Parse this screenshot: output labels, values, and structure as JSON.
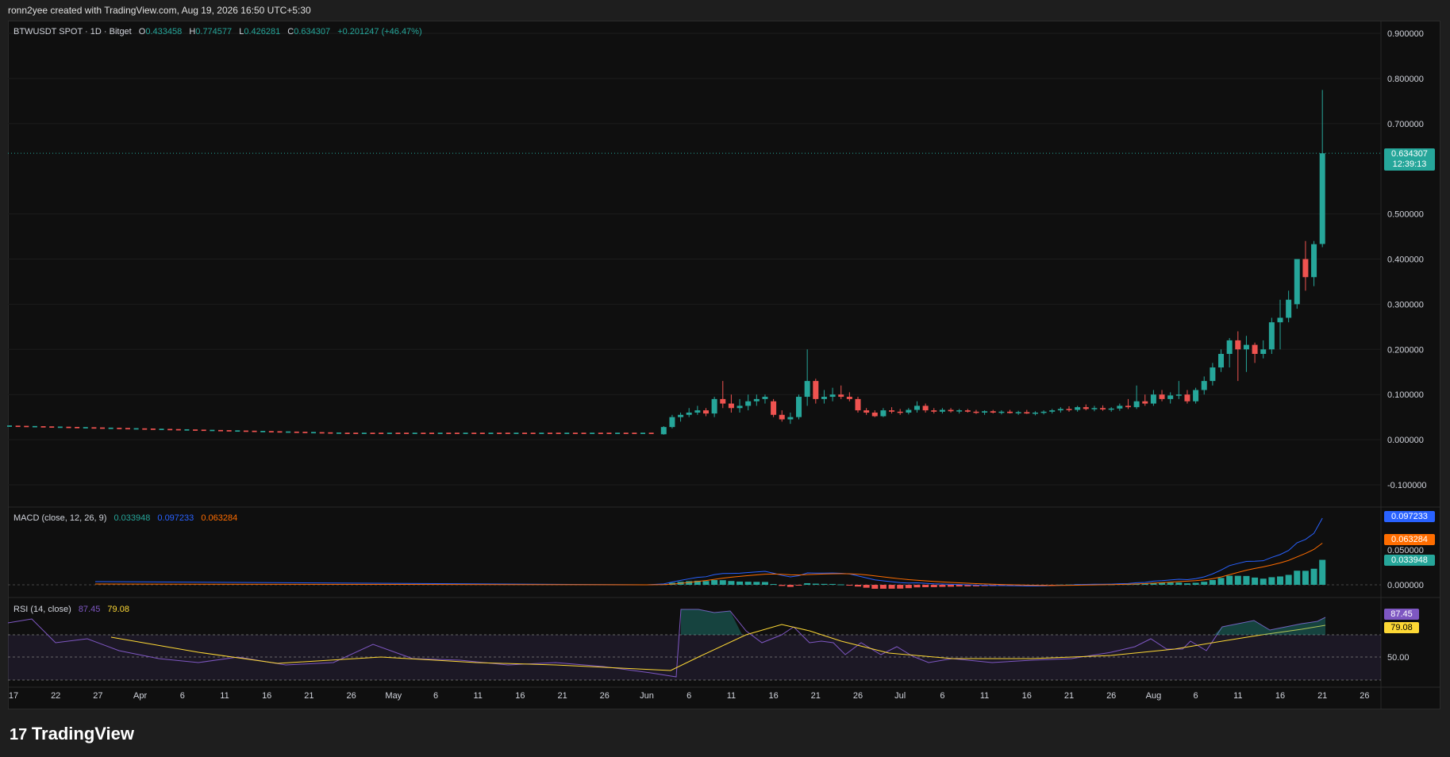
{
  "header": {
    "created_text": "ronn2yee created with TradingView.com, Aug 19, 2026 16:50 UTC+5:30"
  },
  "legend": {
    "symbol": "BTWUSDT SPOT · 1D · Bitget",
    "o_label": "O",
    "o_value": "0.433458",
    "h_label": "H",
    "h_value": "0.774577",
    "l_label": "L",
    "l_value": "0.426281",
    "c_label": "C",
    "c_value": "0.634307",
    "change": "+0.201247 (+46.47%)"
  },
  "price_badge": {
    "value": "0.634307",
    "countdown": "12:39:13"
  },
  "macd_legend": {
    "title": "MACD (close, 12, 26, 9)",
    "hist": "0.033948",
    "macd": "0.097233",
    "signal": "0.063284"
  },
  "macd_badges": {
    "macd": "0.097233",
    "signal": "0.063284",
    "hist": "0.033948"
  },
  "rsi_legend": {
    "title": "RSI (14, close)",
    "rsi": "87.45",
    "ma": "79.08"
  },
  "rsi_badges": {
    "rsi": "87.45",
    "ma": "79.08"
  },
  "brand": {
    "name": "TradingView"
  },
  "colors": {
    "up": "#26a69a",
    "down": "#ef5350",
    "macd": "#2962ff",
    "signal": "#ff6d00",
    "rsi": "#7e57c2",
    "rsi_ma": "#fdd835",
    "background": "#0f0f0f"
  },
  "chart_data": {
    "type": "candlestick",
    "price_axis_ticks": [
      "0.900000",
      "0.800000",
      "0.700000",
      "0.500000",
      "0.400000",
      "0.300000",
      "0.200000",
      "0.100000",
      "0.000000",
      "-0.100000"
    ],
    "ylim": [
      -0.1,
      0.9
    ],
    "x_ticks": [
      "17",
      "22",
      "27",
      "Apr",
      "6",
      "11",
      "16",
      "21",
      "26",
      "May",
      "6",
      "11",
      "16",
      "21",
      "26",
      "Jun",
      "6",
      "11",
      "16",
      "21",
      "26",
      "Jul",
      "6",
      "11",
      "16",
      "21",
      "26",
      "Aug",
      "6",
      "11",
      "16",
      "21",
      "26"
    ],
    "candles_late": [
      {
        "date": "Jun 3",
        "o": 0.012,
        "h": 0.03,
        "l": 0.011,
        "c": 0.028
      },
      {
        "date": "Jun 4",
        "o": 0.028,
        "h": 0.055,
        "l": 0.025,
        "c": 0.05
      },
      {
        "date": "Jun 5",
        "o": 0.05,
        "h": 0.06,
        "l": 0.04,
        "c": 0.055
      },
      {
        "date": "Jun 6",
        "o": 0.055,
        "h": 0.07,
        "l": 0.05,
        "c": 0.06
      },
      {
        "date": "Jun 7",
        "o": 0.06,
        "h": 0.075,
        "l": 0.055,
        "c": 0.065
      },
      {
        "date": "Jun 8",
        "o": 0.065,
        "h": 0.07,
        "l": 0.052,
        "c": 0.058
      },
      {
        "date": "Jun 9",
        "o": 0.058,
        "h": 0.095,
        "l": 0.05,
        "c": 0.09
      },
      {
        "date": "Jun 10",
        "o": 0.09,
        "h": 0.13,
        "l": 0.07,
        "c": 0.08
      },
      {
        "date": "Jun 11",
        "o": 0.08,
        "h": 0.1,
        "l": 0.06,
        "c": 0.07
      },
      {
        "date": "Jun 12",
        "o": 0.07,
        "h": 0.09,
        "l": 0.06,
        "c": 0.075
      },
      {
        "date": "Jun 13",
        "o": 0.075,
        "h": 0.1,
        "l": 0.065,
        "c": 0.085
      },
      {
        "date": "Jun 14",
        "o": 0.085,
        "h": 0.1,
        "l": 0.075,
        "c": 0.09
      },
      {
        "date": "Jun 15",
        "o": 0.09,
        "h": 0.1,
        "l": 0.08,
        "c": 0.095
      },
      {
        "date": "Jun 16",
        "o": 0.085,
        "h": 0.09,
        "l": 0.05,
        "c": 0.055
      },
      {
        "date": "Jun 17",
        "o": 0.055,
        "h": 0.065,
        "l": 0.04,
        "c": 0.045
      },
      {
        "date": "Jun 18",
        "o": 0.045,
        "h": 0.06,
        "l": 0.035,
        "c": 0.05
      },
      {
        "date": "Jun 19",
        "o": 0.05,
        "h": 0.1,
        "l": 0.045,
        "c": 0.095
      },
      {
        "date": "Jun 20",
        "o": 0.095,
        "h": 0.2,
        "l": 0.075,
        "c": 0.13
      },
      {
        "date": "Jun 21",
        "o": 0.13,
        "h": 0.135,
        "l": 0.08,
        "c": 0.09
      },
      {
        "date": "Jun 22",
        "o": 0.09,
        "h": 0.11,
        "l": 0.08,
        "c": 0.095
      },
      {
        "date": "Jun 23",
        "o": 0.095,
        "h": 0.115,
        "l": 0.085,
        "c": 0.1
      },
      {
        "date": "Jun 24",
        "o": 0.1,
        "h": 0.12,
        "l": 0.09,
        "c": 0.095
      },
      {
        "date": "Jun 25",
        "o": 0.095,
        "h": 0.105,
        "l": 0.085,
        "c": 0.09
      },
      {
        "date": "Jun 26",
        "o": 0.09,
        "h": 0.095,
        "l": 0.06,
        "c": 0.065
      },
      {
        "date": "Jun 27",
        "o": 0.065,
        "h": 0.07,
        "l": 0.055,
        "c": 0.06
      },
      {
        "date": "Jun 28",
        "o": 0.06,
        "h": 0.065,
        "l": 0.05,
        "c": 0.052
      },
      {
        "date": "Jun 29",
        "o": 0.052,
        "h": 0.07,
        "l": 0.05,
        "c": 0.065
      },
      {
        "date": "Jun 30",
        "o": 0.065,
        "h": 0.072,
        "l": 0.058,
        "c": 0.062
      },
      {
        "date": "Jul 1",
        "o": 0.062,
        "h": 0.068,
        "l": 0.055,
        "c": 0.06
      },
      {
        "date": "Jul 2",
        "o": 0.06,
        "h": 0.07,
        "l": 0.056,
        "c": 0.066
      },
      {
        "date": "Jul 3",
        "o": 0.066,
        "h": 0.085,
        "l": 0.06,
        "c": 0.075
      },
      {
        "date": "Jul 4",
        "o": 0.075,
        "h": 0.08,
        "l": 0.06,
        "c": 0.065
      },
      {
        "date": "Jul 5",
        "o": 0.065,
        "h": 0.07,
        "l": 0.058,
        "c": 0.062
      },
      {
        "date": "Jul 6",
        "o": 0.062,
        "h": 0.07,
        "l": 0.058,
        "c": 0.066
      },
      {
        "date": "Jul 7",
        "o": 0.066,
        "h": 0.07,
        "l": 0.06,
        "c": 0.063
      },
      {
        "date": "Jul 8",
        "o": 0.063,
        "h": 0.068,
        "l": 0.058,
        "c": 0.065
      },
      {
        "date": "Jul 9",
        "o": 0.065,
        "h": 0.068,
        "l": 0.06,
        "c": 0.062
      },
      {
        "date": "Jul 10",
        "o": 0.062,
        "h": 0.066,
        "l": 0.057,
        "c": 0.06
      },
      {
        "date": "Jul 11",
        "o": 0.06,
        "h": 0.065,
        "l": 0.055,
        "c": 0.063
      },
      {
        "date": "Jul 12",
        "o": 0.063,
        "h": 0.066,
        "l": 0.058,
        "c": 0.06
      },
      {
        "date": "Jul 13",
        "o": 0.06,
        "h": 0.065,
        "l": 0.056,
        "c": 0.062
      },
      {
        "date": "Jul 14",
        "o": 0.062,
        "h": 0.066,
        "l": 0.058,
        "c": 0.059
      },
      {
        "date": "Jul 15",
        "o": 0.059,
        "h": 0.064,
        "l": 0.055,
        "c": 0.061
      },
      {
        "date": "Jul 16",
        "o": 0.061,
        "h": 0.066,
        "l": 0.057,
        "c": 0.058
      },
      {
        "date": "Jul 17",
        "o": 0.058,
        "h": 0.063,
        "l": 0.054,
        "c": 0.06
      },
      {
        "date": "Jul 18",
        "o": 0.06,
        "h": 0.065,
        "l": 0.056,
        "c": 0.062
      },
      {
        "date": "Jul 19",
        "o": 0.062,
        "h": 0.068,
        "l": 0.058,
        "c": 0.065
      },
      {
        "date": "Jul 20",
        "o": 0.065,
        "h": 0.072,
        "l": 0.06,
        "c": 0.068
      },
      {
        "date": "Jul 21",
        "o": 0.068,
        "h": 0.074,
        "l": 0.062,
        "c": 0.066
      },
      {
        "date": "Jul 22",
        "o": 0.066,
        "h": 0.075,
        "l": 0.062,
        "c": 0.072
      },
      {
        "date": "Jul 23",
        "o": 0.072,
        "h": 0.078,
        "l": 0.065,
        "c": 0.068
      },
      {
        "date": "Jul 24",
        "o": 0.068,
        "h": 0.075,
        "l": 0.063,
        "c": 0.07
      },
      {
        "date": "Jul 25",
        "o": 0.07,
        "h": 0.076,
        "l": 0.064,
        "c": 0.067
      },
      {
        "date": "Jul 26",
        "o": 0.067,
        "h": 0.072,
        "l": 0.062,
        "c": 0.069
      },
      {
        "date": "Jul 27",
        "o": 0.069,
        "h": 0.08,
        "l": 0.064,
        "c": 0.075
      },
      {
        "date": "Jul 28",
        "o": 0.075,
        "h": 0.09,
        "l": 0.068,
        "c": 0.072
      },
      {
        "date": "Jul 29",
        "o": 0.072,
        "h": 0.12,
        "l": 0.068,
        "c": 0.085
      },
      {
        "date": "Jul 30",
        "o": 0.085,
        "h": 0.1,
        "l": 0.075,
        "c": 0.08
      },
      {
        "date": "Jul 31",
        "o": 0.08,
        "h": 0.11,
        "l": 0.075,
        "c": 0.1
      },
      {
        "date": "Aug 1",
        "o": 0.1,
        "h": 0.11,
        "l": 0.085,
        "c": 0.09
      },
      {
        "date": "Aug 2",
        "o": 0.09,
        "h": 0.105,
        "l": 0.08,
        "c": 0.098
      },
      {
        "date": "Aug 3",
        "o": 0.098,
        "h": 0.13,
        "l": 0.09,
        "c": 0.1
      },
      {
        "date": "Aug 4",
        "o": 0.1,
        "h": 0.11,
        "l": 0.08,
        "c": 0.085
      },
      {
        "date": "Aug 5",
        "o": 0.085,
        "h": 0.115,
        "l": 0.08,
        "c": 0.11
      },
      {
        "date": "Aug 6",
        "o": 0.11,
        "h": 0.14,
        "l": 0.1,
        "c": 0.13
      },
      {
        "date": "Aug 7",
        "o": 0.13,
        "h": 0.17,
        "l": 0.12,
        "c": 0.16
      },
      {
        "date": "Aug 8",
        "o": 0.16,
        "h": 0.2,
        "l": 0.15,
        "c": 0.19
      },
      {
        "date": "Aug 9",
        "o": 0.19,
        "h": 0.225,
        "l": 0.16,
        "c": 0.22
      },
      {
        "date": "Aug 10",
        "o": 0.22,
        "h": 0.24,
        "l": 0.13,
        "c": 0.2
      },
      {
        "date": "Aug 11",
        "o": 0.2,
        "h": 0.23,
        "l": 0.15,
        "c": 0.21
      },
      {
        "date": "Aug 12",
        "o": 0.21,
        "h": 0.215,
        "l": 0.17,
        "c": 0.19
      },
      {
        "date": "Aug 13",
        "o": 0.19,
        "h": 0.22,
        "l": 0.18,
        "c": 0.2
      },
      {
        "date": "Aug 14",
        "o": 0.2,
        "h": 0.27,
        "l": 0.19,
        "c": 0.26
      },
      {
        "date": "Aug 15",
        "o": 0.26,
        "h": 0.31,
        "l": 0.2,
        "c": 0.27
      },
      {
        "date": "Aug 16",
        "o": 0.27,
        "h": 0.33,
        "l": 0.26,
        "c": 0.31
      },
      {
        "date": "Aug 17",
        "o": 0.3,
        "h": 0.4,
        "l": 0.29,
        "c": 0.4
      },
      {
        "date": "Aug 18",
        "o": 0.4,
        "h": 0.44,
        "l": 0.33,
        "c": 0.36
      },
      {
        "date": "Aug 19",
        "o": 0.36,
        "h": 0.44,
        "l": 0.34,
        "c": 0.433
      },
      {
        "date": "Aug 20",
        "o": 0.433458,
        "h": 0.774577,
        "l": 0.426281,
        "c": 0.634307
      }
    ]
  }
}
